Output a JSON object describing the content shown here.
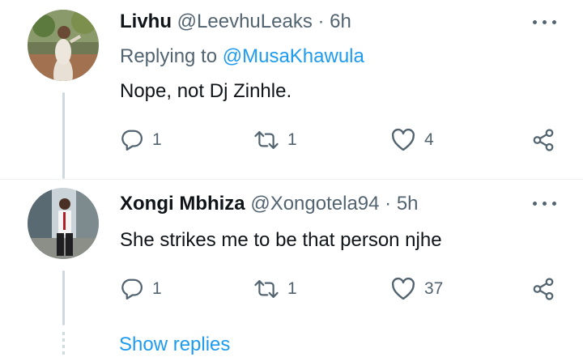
{
  "tweets": [
    {
      "name": "Livhu",
      "handle": "@LeevhuLeaks",
      "separator": "·",
      "time": "6h",
      "replying_label": "Replying to",
      "replying_to": "@MusaKhawula",
      "text": "Nope, not Dj Zinhle.",
      "replies": "1",
      "retweets": "1",
      "likes": "4"
    },
    {
      "name": "Xongi Mbhiza",
      "handle": "@Xongotela94",
      "separator": "·",
      "time": "5h",
      "text": "She strikes me to be that person njhe",
      "replies": "1",
      "retweets": "1",
      "likes": "37"
    }
  ],
  "show_replies": "Show replies",
  "colors": {
    "accent": "#1d9bf0",
    "secondary_text": "#536471",
    "primary_text": "#0f1419",
    "thread_line": "#cfd9de"
  },
  "icons": [
    "more-icon",
    "reply-icon",
    "retweet-icon",
    "like-icon",
    "share-icon"
  ]
}
